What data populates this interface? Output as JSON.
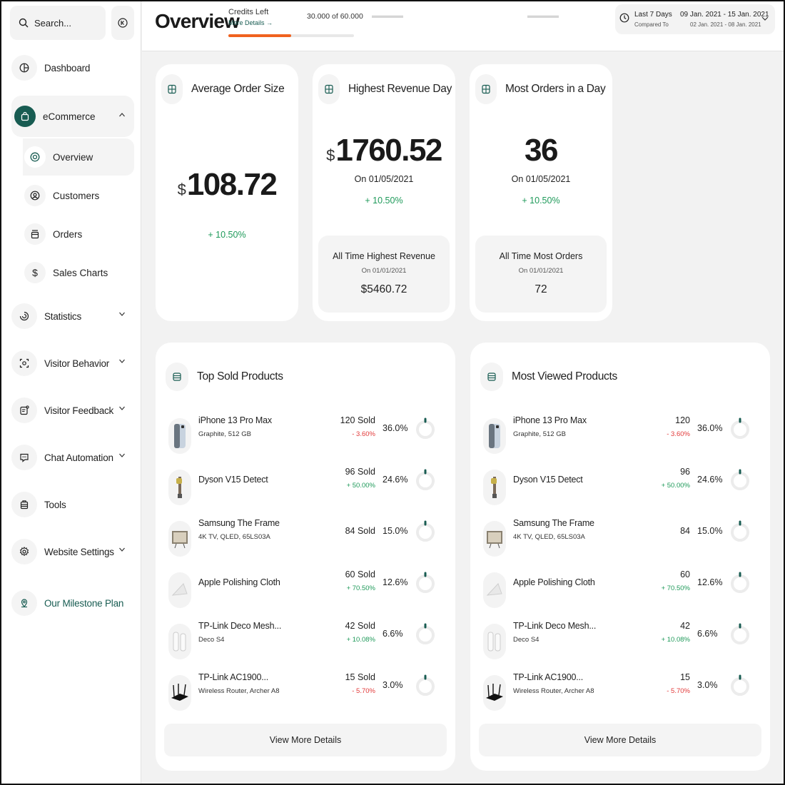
{
  "sidebar": {
    "search_placeholder": "Search...",
    "items": [
      {
        "label": "Dashboard"
      },
      {
        "label": "eCommerce"
      },
      {
        "label": "Statistics"
      },
      {
        "label": "Visitor Behavior"
      },
      {
        "label": "Visitor Feedback"
      },
      {
        "label": "Chat Automation"
      },
      {
        "label": "Tools"
      },
      {
        "label": "Website Settings"
      },
      {
        "label": "Our Milestone Plan"
      }
    ],
    "ecommerce_sub": [
      {
        "label": "Overview",
        "active": true
      },
      {
        "label": "Customers"
      },
      {
        "label": "Orders"
      },
      {
        "label": "Sales Charts"
      }
    ],
    "accent_color": "#185c52"
  },
  "header": {
    "title": "Overview",
    "credits_label": "Credits Left",
    "more_details": "More Details →",
    "credits_value": "30.000 of 60.000",
    "credits_used_fraction": 0.5,
    "progress_color": "#f0621f",
    "date_range_label": "Last 7 Days",
    "compared_to_label": "Compared To",
    "date_range": "09 Jan. 2021 - 15 Jan. 2021",
    "compare_range": "02 Jan. 2021 - 08 Jan. 2021"
  },
  "stats": {
    "average_order": {
      "title": "Average Order Size",
      "currency": "$",
      "value": "108.72",
      "change": "+ 10.50%"
    },
    "highest_revenue": {
      "title": "Highest Revenue Day",
      "currency": "$",
      "value": "1760.52",
      "date": "On 01/05/2021",
      "change": "+ 10.50%",
      "all_time_title": "All Time Highest Revenue",
      "all_time_date": "On 01/01/2021",
      "all_time_value": "$5460.72"
    },
    "most_orders": {
      "title": "Most Orders in a Day",
      "value": "36",
      "date": "On 01/05/2021",
      "change": "+ 10.50%",
      "all_time_title": "All Time Most Orders",
      "all_time_date": "On 01/01/2021",
      "all_time_value": "72"
    }
  },
  "top_sold": {
    "title": "Top Sold Products",
    "view_more": "View More Details",
    "items": [
      {
        "name": "iPhone 13 Pro Max",
        "sub": "Graphite, 512 GB",
        "count": "120 Sold",
        "change": "- 3.60%",
        "trend": "down",
        "share": "36.0%"
      },
      {
        "name": "Dyson V15 Detect",
        "sub": "",
        "count": "96 Sold",
        "change": "+ 50.00%",
        "trend": "up",
        "share": "24.6%"
      },
      {
        "name": "Samsung The Frame",
        "sub": "4K TV, QLED, 65LS03A",
        "count": "84 Sold",
        "change": "",
        "trend": "",
        "share": "15.0%"
      },
      {
        "name": "Apple Polishing Cloth",
        "sub": "",
        "count": "60 Sold",
        "change": "+ 70.50%",
        "trend": "up",
        "share": "12.6%"
      },
      {
        "name": "TP-Link Deco Mesh...",
        "sub": "Deco S4",
        "count": "42 Sold",
        "change": "+ 10.08%",
        "trend": "up",
        "share": "6.6%"
      },
      {
        "name": "TP-Link AC1900...",
        "sub": "Wireless Router, Archer A8",
        "count": "15 Sold",
        "change": "- 5.70%",
        "trend": "down",
        "share": "3.0%"
      }
    ]
  },
  "most_viewed": {
    "title": "Most Viewed Products",
    "view_more": "View More Details",
    "items": [
      {
        "name": "iPhone 13 Pro Max",
        "sub": "Graphite, 512 GB",
        "count": "120",
        "change": "- 3.60%",
        "trend": "down",
        "share": "36.0%"
      },
      {
        "name": "Dyson V15 Detect",
        "sub": "",
        "count": "96",
        "change": "+ 50.00%",
        "trend": "up",
        "share": "24.6%"
      },
      {
        "name": "Samsung The Frame",
        "sub": "4K TV, QLED, 65LS03A",
        "count": "84",
        "change": "",
        "trend": "",
        "share": "15.0%"
      },
      {
        "name": "Apple Polishing Cloth",
        "sub": "",
        "count": "60",
        "change": "+ 70.50%",
        "trend": "up",
        "share": "12.6%"
      },
      {
        "name": "TP-Link Deco Mesh...",
        "sub": "Deco S4",
        "count": "42",
        "change": "+ 10.08%",
        "trend": "up",
        "share": "6.6%"
      },
      {
        "name": "TP-Link AC1900...",
        "sub": "Wireless Router, Archer A8",
        "count": "15",
        "change": "- 5.70%",
        "trend": "down",
        "share": "3.0%"
      }
    ]
  }
}
